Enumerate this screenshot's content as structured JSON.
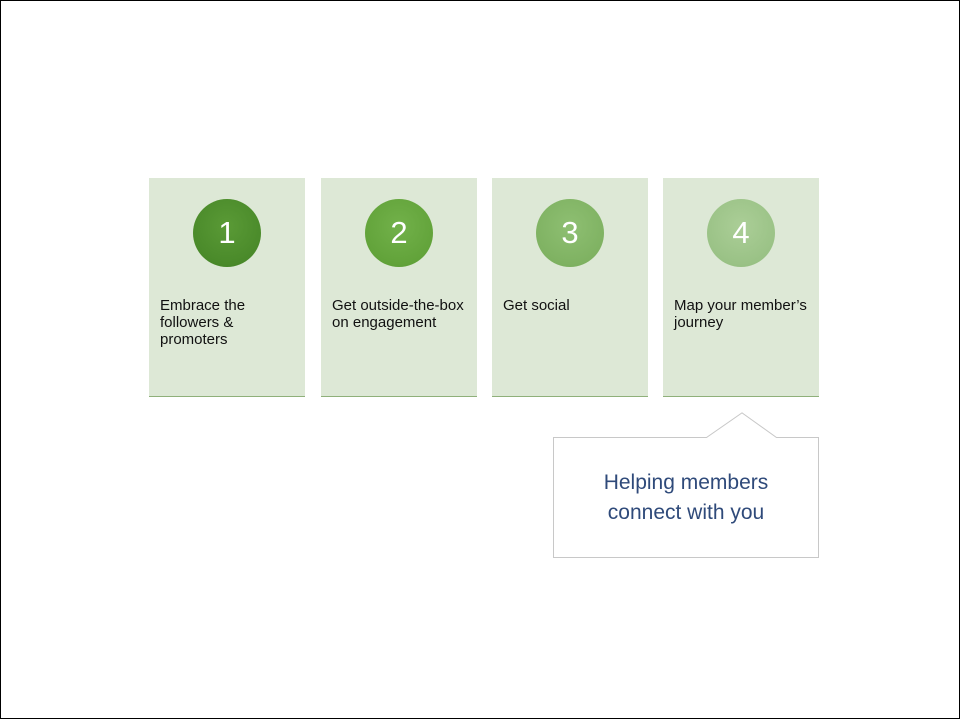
{
  "steps": [
    {
      "number": "1",
      "label": "Embrace the followers & promoters"
    },
    {
      "number": "2",
      "label": "Get outside-the-box on engagement"
    },
    {
      "number": "3",
      "label": "Get social"
    },
    {
      "number": "4",
      "label": "Map your member’s journey"
    }
  ],
  "callout": {
    "line1": "Helping members",
    "line2": "connect with you"
  },
  "colors": {
    "card_background": "#dde8d6",
    "badge_1": "#4a8a2a",
    "badge_2": "#62a33a",
    "badge_3": "#7fb262",
    "badge_4": "#9ac286",
    "callout_text": "#2f4a7a"
  }
}
